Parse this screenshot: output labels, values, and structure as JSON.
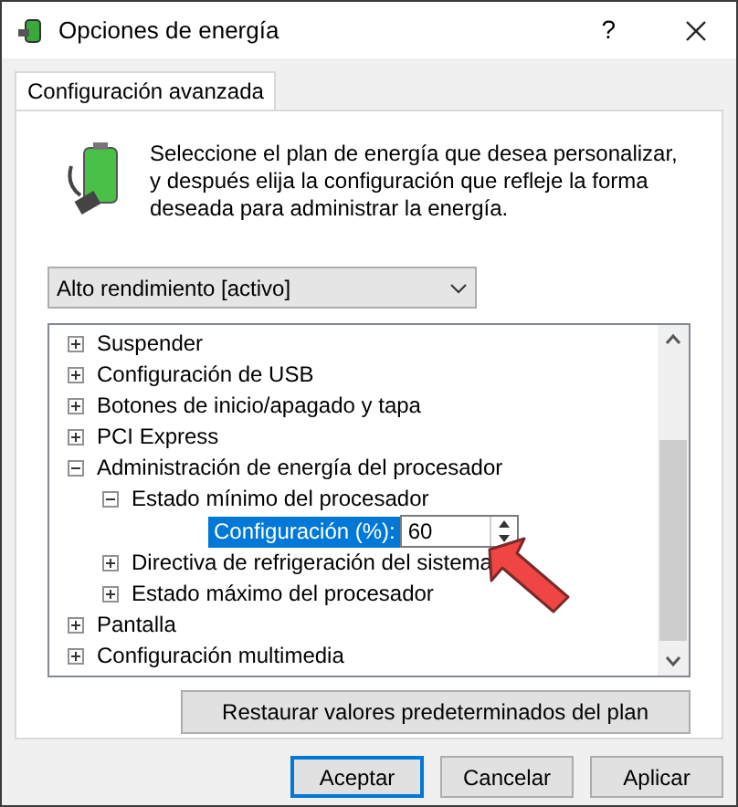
{
  "window": {
    "title": "Opciones de energía",
    "help": "?"
  },
  "tabs": [
    {
      "label": "Configuración avanzada",
      "selected": true
    }
  ],
  "description": "Seleccione el plan de energía que desea personalizar, y después elija la configuración que refleje la forma deseada para administrar la energía.",
  "plan_dropdown": {
    "value": "Alto rendimiento [activo]"
  },
  "tree": [
    {
      "label": "Suspender",
      "expanded": false
    },
    {
      "label": "Configuración de USB",
      "expanded": false
    },
    {
      "label": "Botones de inicio/apagado y tapa",
      "expanded": false
    },
    {
      "label": "PCI Express",
      "expanded": false
    },
    {
      "label": "Administración de energía del procesador",
      "expanded": true,
      "children": [
        {
          "label": "Estado mínimo del procesador",
          "expanded": true,
          "setting": {
            "label": "Configuración (%):",
            "value": "60",
            "selected": true
          }
        },
        {
          "label": "Directiva de refrigeración del sistema",
          "expanded": false
        },
        {
          "label": "Estado máximo del procesador",
          "expanded": false
        }
      ]
    },
    {
      "label": "Pantalla",
      "expanded": false
    },
    {
      "label": "Configuración multimedia",
      "expanded": false
    }
  ],
  "restore_button": "Restaurar valores predeterminados del plan",
  "buttons": [
    {
      "label": "Aceptar",
      "default": true
    },
    {
      "label": "Cancelar",
      "default": false
    },
    {
      "label": "Aplicar",
      "default": false
    }
  ]
}
